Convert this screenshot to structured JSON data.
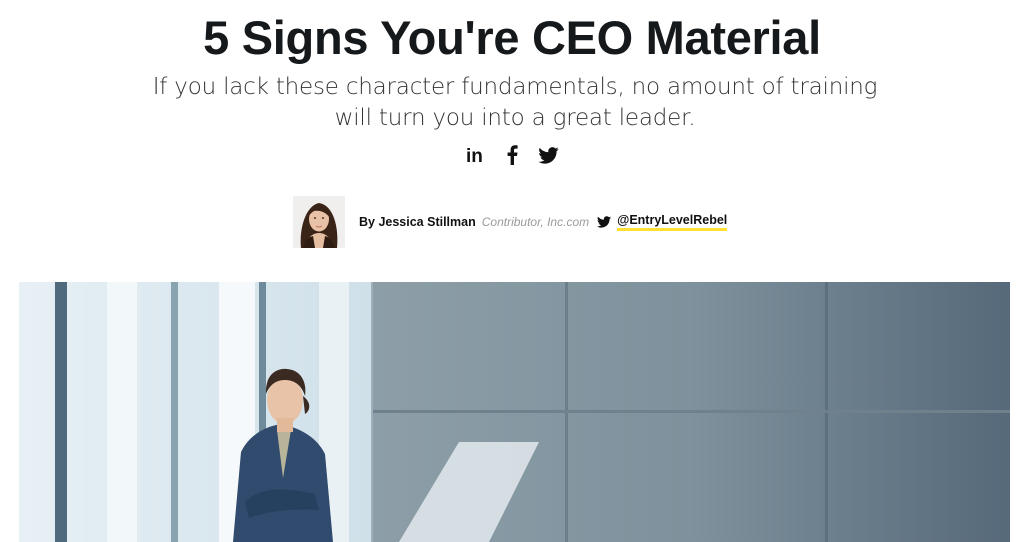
{
  "article": {
    "headline": "5 Signs You're CEO Material",
    "dek": "If you lack these character fundamentals, no amount of training will turn you into a great leader."
  },
  "share": [
    {
      "icon": "linkedin-icon",
      "label": "in"
    },
    {
      "icon": "facebook-icon",
      "label": "f"
    },
    {
      "icon": "twitter-icon",
      "label": "twitter"
    }
  ],
  "byline": {
    "prefix": "By Jessica Stillman",
    "role": "Contributor, Inc.com",
    "twitter_handle": "@EntryLevelRebel"
  },
  "colors": {
    "handle_underline": "#ffe033",
    "headline": "#16191c"
  }
}
